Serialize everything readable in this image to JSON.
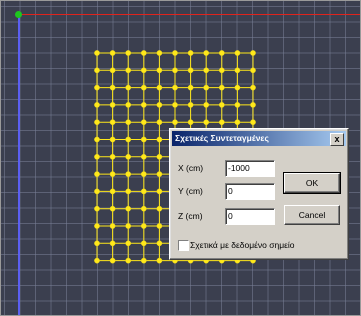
{
  "colors": {
    "viewport_bg": "#3b3f4f",
    "grid_line": "#787f96",
    "x_axis": "#e0231c",
    "y_axis": "#5b5ff2",
    "origin": "#1ec61e",
    "node": "#ffe81a",
    "node_edge": "#e6d21a",
    "titlebar_start": "#0a246a",
    "titlebar_end": "#a6caf0"
  },
  "dialog": {
    "title": "Σχετικές Συντεταγμένες",
    "close_label": "x",
    "fields": [
      {
        "label": "X (cm)",
        "value": "-1000"
      },
      {
        "label": "Y (cm)",
        "value": "0"
      },
      {
        "label": "Z (cm)",
        "value": "0"
      }
    ],
    "ok_label": "OK",
    "cancel_label": "Cancel",
    "checkbox_label": "Σχετικά με δεδομένο σημείο",
    "checkbox_checked": false
  }
}
